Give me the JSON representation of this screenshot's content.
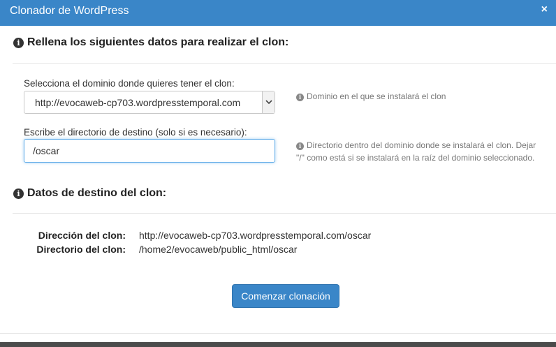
{
  "dialog": {
    "title": "Clonador de WordPress",
    "close_glyph": "×"
  },
  "form": {
    "heading": "Rellena los siguientes datos para realizar el clon:",
    "domain_label": "Selecciona el dominio donde quieres tener el clon:",
    "domain_value": "http://evocaweb-cp703.wordpresstemporal.com",
    "domain_hint": "Dominio en el que se instalará el clon",
    "dir_label": "Escribe el directorio de destino (solo si es necesario):",
    "dir_value": "/oscar",
    "dir_hint_line1": "Directorio dentro del dominio donde se instalará el clon. Dejar",
    "dir_hint_line2": "\"/\" como está si se instalará en la raíz del dominio seleccionado."
  },
  "destination": {
    "heading": "Datos de destino del clon:",
    "address_key": "Dirección del clon:",
    "address_value": "http://evocaweb-cp703.wordpresstemporal.com/oscar",
    "directory_key": "Directorio del clon:",
    "directory_value": "/home2/evocaweb/public_html/oscar"
  },
  "actions": {
    "start_label": "Comenzar clonación"
  },
  "icons": {
    "info": "info-circle-icon",
    "close": "close-icon",
    "dropdown": "chevron-down-icon"
  },
  "colors": {
    "header": "#3a86c8",
    "button": "#3a86c8",
    "focus": "#66afe9"
  }
}
